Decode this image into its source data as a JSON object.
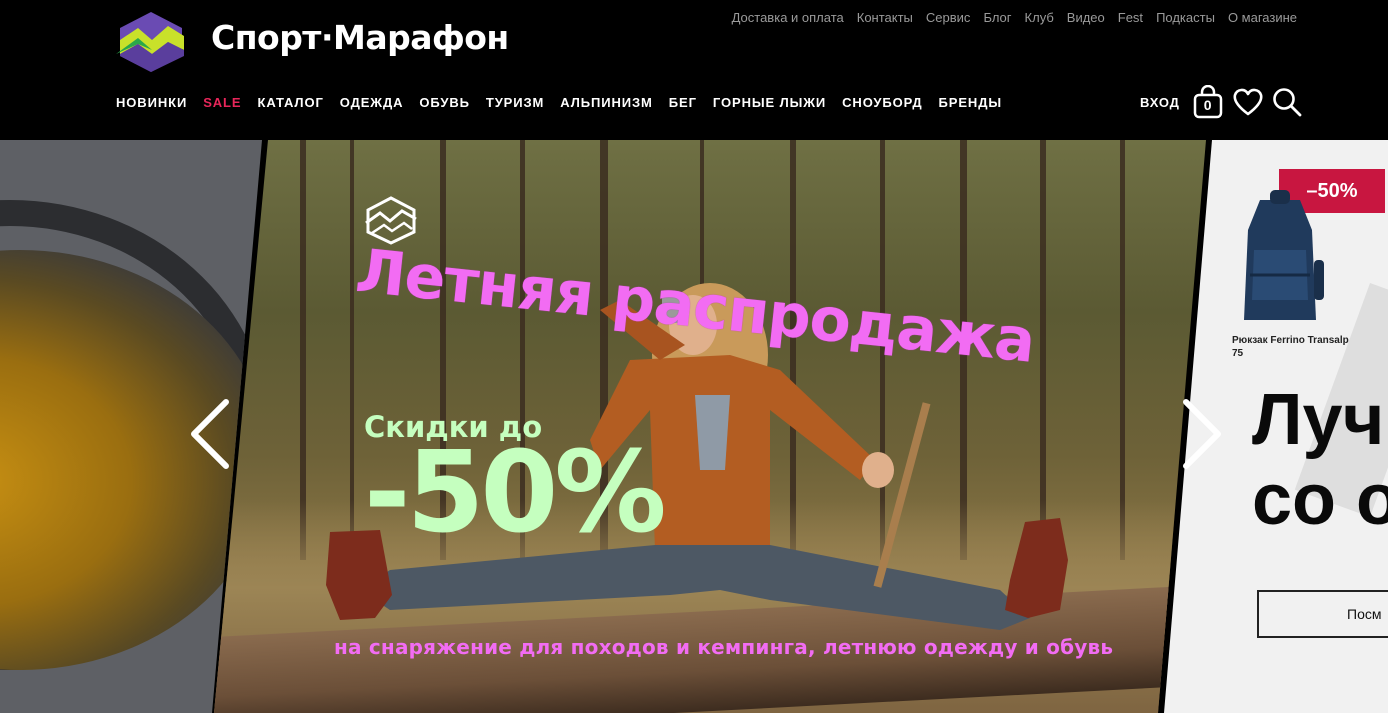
{
  "header": {
    "brand": "Спорт·Марафон",
    "top_links": [
      "Доставка и оплата",
      "Контакты",
      "Сервис",
      "Блог",
      "Клуб",
      "Видео",
      "Fest",
      "Подкасты",
      "О магазине"
    ],
    "nav": [
      "НОВИНКИ",
      "SALE",
      "КАТАЛОГ",
      "ОДЕЖДА",
      "ОБУВЬ",
      "ТУРИЗМ",
      "АЛЬПИНИЗМ",
      "БЕГ",
      "ГОРНЫЕ ЛЫЖИ",
      "СНОУБОРД",
      "БРЕНДЫ"
    ],
    "login_label": "ВХОД",
    "cart_count": "0",
    "icons": [
      "cart-icon",
      "heart-icon",
      "search-icon"
    ]
  },
  "slider": {
    "main": {
      "title": "Летняя распродажа",
      "sub": "Скидки до",
      "discount": "-50%",
      "footer": "на снаряжение для походов и кемпинга, летнюю одежду и обувь"
    },
    "right": {
      "badge": "–50%",
      "product_caption": "Рюкзак Ferrino Transalp 75",
      "headline_line1": "Луч",
      "headline_line2": "со о",
      "button": "Посм"
    }
  },
  "colors": {
    "sale": "#e8265a",
    "promo_pink": "#f26cf3",
    "promo_green": "#c5ffbf",
    "badge_red": "#c81640"
  }
}
